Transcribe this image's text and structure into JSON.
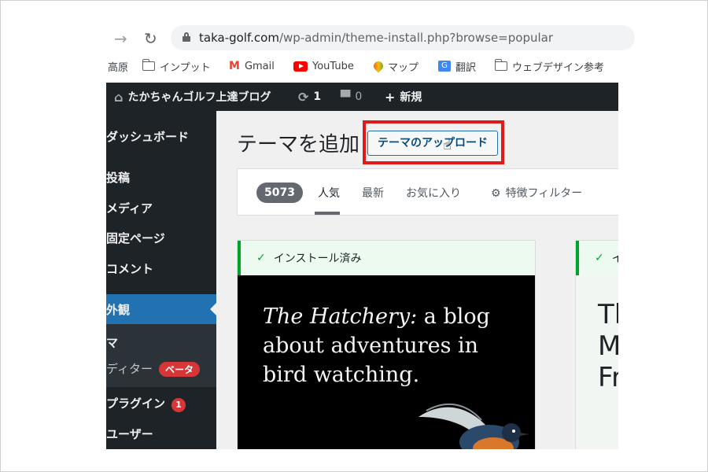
{
  "browser": {
    "url_host": "taka-golf.com",
    "url_path": "/wp-admin/theme-install.php?browse=popular",
    "bookmarks": [
      {
        "label": "高原",
        "icon": "none"
      },
      {
        "label": "インプット",
        "icon": "folder-icon"
      },
      {
        "label": "Gmail",
        "icon": "gmail-icon"
      },
      {
        "label": "YouTube",
        "icon": "youtube-icon"
      },
      {
        "label": "マップ",
        "icon": "maps-icon"
      },
      {
        "label": "翻訳",
        "icon": "translate-icon"
      },
      {
        "label": "ウェブデザイン参考",
        "icon": "folder-icon"
      }
    ]
  },
  "adminbar": {
    "site_name": "たかちゃんゴルフ上達ブログ",
    "updates_count": "1",
    "comments_count": "0",
    "new_label": "新規"
  },
  "sidebar": {
    "items": [
      "ダッシュボード",
      "投稿",
      "メディア",
      "固定ページ",
      "コメント",
      "外観",
      "マ",
      "ディター",
      "プラグイン",
      "ユーザー"
    ],
    "beta_badge": "ベータ",
    "plugins_badge": "1"
  },
  "main": {
    "title": "テーマを追加",
    "upload_button": "テーマのアップロード",
    "theme_count": "5073",
    "tabs": [
      "人気",
      "最新",
      "お気に入り"
    ],
    "feature_filter": "特徴フィルター",
    "installed_notice": "インストール済み",
    "card1_heading_italic": "The Hatchery:",
    "card1_heading_rest": " a blog about adventures in bird watching.",
    "card2_notice_fragment": "イ",
    "card2_text": "Tl\nM\nFr"
  },
  "colors": {
    "admin_dark": "#1d2327",
    "admin_blue": "#2271b1",
    "highlight_red": "#e0191c",
    "installed_green": "#00a32a"
  }
}
